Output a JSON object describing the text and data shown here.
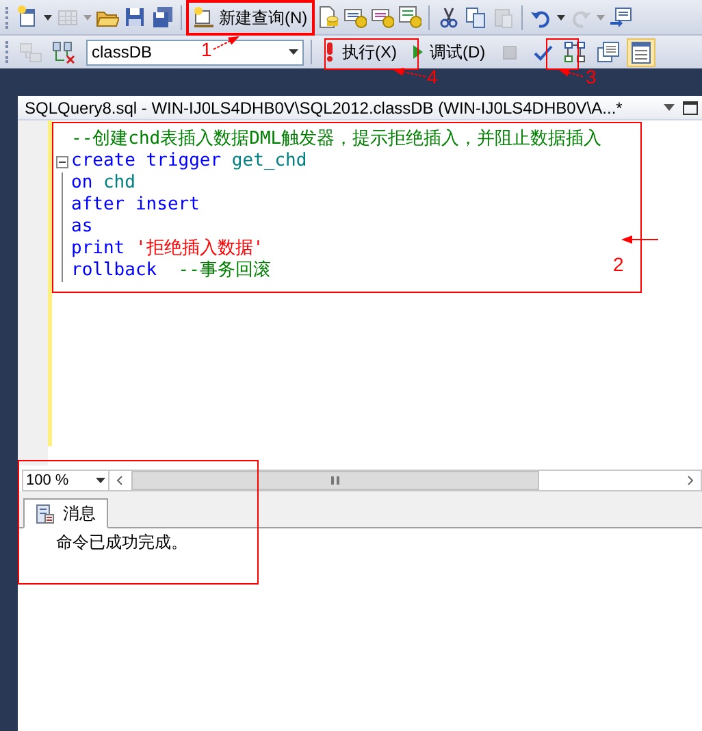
{
  "toolbar_1": [
    {
      "kind": "new-project",
      "dropdown": true,
      "disabled": false
    },
    {
      "kind": "add-item",
      "dropdown": true,
      "disabled": true
    },
    {
      "kind": "open",
      "dropdown": false,
      "disabled": false
    },
    {
      "kind": "save",
      "dropdown": false,
      "disabled": false
    },
    {
      "kind": "save-all",
      "dropdown": false,
      "disabled": false
    },
    {
      "kind": "separator"
    },
    {
      "kind": "text-button",
      "label": "新建查询(N)"
    },
    {
      "kind": "db-query",
      "dropdown": false,
      "disabled": false
    },
    {
      "kind": "mdx",
      "dropdown": false,
      "disabled": false
    },
    {
      "kind": "dmx",
      "dropdown": false,
      "disabled": false
    },
    {
      "kind": "xmla",
      "dropdown": false,
      "disabled": false
    },
    {
      "kind": "separator"
    },
    {
      "kind": "cut",
      "dropdown": false,
      "disabled": false
    },
    {
      "kind": "copy",
      "dropdown": false,
      "disabled": false
    },
    {
      "kind": "paste",
      "dropdown": false,
      "disabled": true
    },
    {
      "kind": "separator"
    },
    {
      "kind": "undo",
      "dropdown": true,
      "disabled": false
    },
    {
      "kind": "redo",
      "dropdown": true,
      "disabled": true
    },
    {
      "kind": "window",
      "dropdown": false,
      "disabled": false
    }
  ],
  "toolbar_2": [
    {
      "kind": "connect",
      "disabled": true
    },
    {
      "kind": "change-connection",
      "disabled": false
    },
    {
      "kind": "database-select",
      "value": "classDB"
    },
    {
      "kind": "separator"
    },
    {
      "kind": "execute",
      "label": "执行(X)",
      "disabled": false
    },
    {
      "kind": "debug",
      "label": "调试(D)",
      "disabled": false
    },
    {
      "kind": "stop",
      "disabled": true
    },
    {
      "kind": "parse",
      "disabled": false,
      "selected": false
    },
    {
      "kind": "plan",
      "disabled": false,
      "selected": false
    },
    {
      "kind": "results-text",
      "disabled": false,
      "selected": false
    },
    {
      "kind": "results-grid",
      "disabled": false,
      "selected": true
    }
  ],
  "document": {
    "title": "SQLQuery8.sql - WIN-IJ0LS4DHB0V\\SQL2012.classDB (WIN-IJ0LS4DHB0V\\A...*"
  },
  "editor": {
    "lines": [
      {
        "fold": false,
        "tokens": [
          {
            "kind": "comment",
            "text": "--创建chd表插入数据DML触发器，提示拒绝插入，并阻止数据插入"
          }
        ]
      },
      {
        "fold": true,
        "tokens": [
          {
            "kind": "keyword",
            "text": "create"
          },
          {
            "kind": "keyword",
            "text": "trigger"
          },
          {
            "kind": "identifier",
            "text": "get_chd"
          }
        ]
      },
      {
        "fold": false,
        "tokens": [
          {
            "kind": "keyword",
            "text": "on"
          },
          {
            "kind": "identifier",
            "text": "chd"
          }
        ]
      },
      {
        "fold": false,
        "tokens": [
          {
            "kind": "keyword",
            "text": "after"
          },
          {
            "kind": "keyword",
            "text": "insert"
          }
        ]
      },
      {
        "fold": false,
        "tokens": [
          {
            "kind": "keyword",
            "text": "as"
          }
        ]
      },
      {
        "fold": false,
        "tokens": [
          {
            "kind": "keyword",
            "text": "print"
          },
          {
            "kind": "string",
            "text": "'拒绝插入数据'"
          }
        ]
      },
      {
        "fold": false,
        "tokens": [
          {
            "kind": "keyword",
            "text": "rollback"
          },
          {
            "kind": "comment",
            "text": " --事务回滚"
          }
        ]
      }
    ]
  },
  "zoom": {
    "value": "100 %"
  },
  "results": {
    "tabs": [
      {
        "label": "消息",
        "selected": true
      }
    ],
    "messages": [
      "命令已成功完成。"
    ]
  },
  "annotations": [
    {
      "label": "1"
    },
    {
      "label": "2"
    },
    {
      "label": "3"
    },
    {
      "label": "4"
    }
  ]
}
